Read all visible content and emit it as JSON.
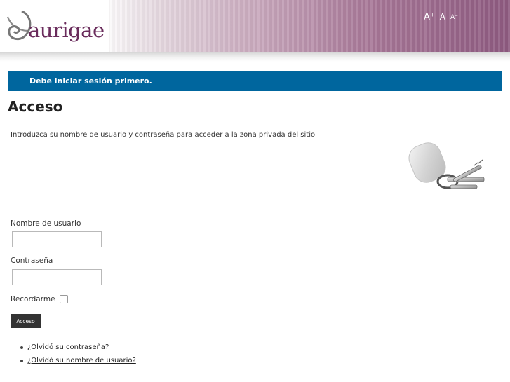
{
  "header": {
    "logo_text": "aurigae",
    "font_controls": {
      "increase": "A⁺",
      "normal": "A",
      "decrease": "A⁻"
    }
  },
  "message": "Debe iniciar sesión primero.",
  "page": {
    "title": "Acceso",
    "intro": "Introduzca su nombre de usuario y contraseña para acceder a la zona privada del sitio"
  },
  "form": {
    "username_label": "Nombre de usuario",
    "username_value": "",
    "password_label": "Contraseña",
    "password_value": "",
    "remember_label": "Recordarme",
    "remember_checked": false,
    "submit_label": "Acceso"
  },
  "links": {
    "forgot_password": "¿Olvidó su contraseña?",
    "forgot_username": "¿Olvidó su nombre de usuario?"
  },
  "colors": {
    "message_bar": "#00669e",
    "logo": "#6a2c5c",
    "header_accent": "#8e5a80",
    "button": "#333333"
  },
  "icons": [
    "logo-swirl-icon",
    "keys-icon"
  ]
}
